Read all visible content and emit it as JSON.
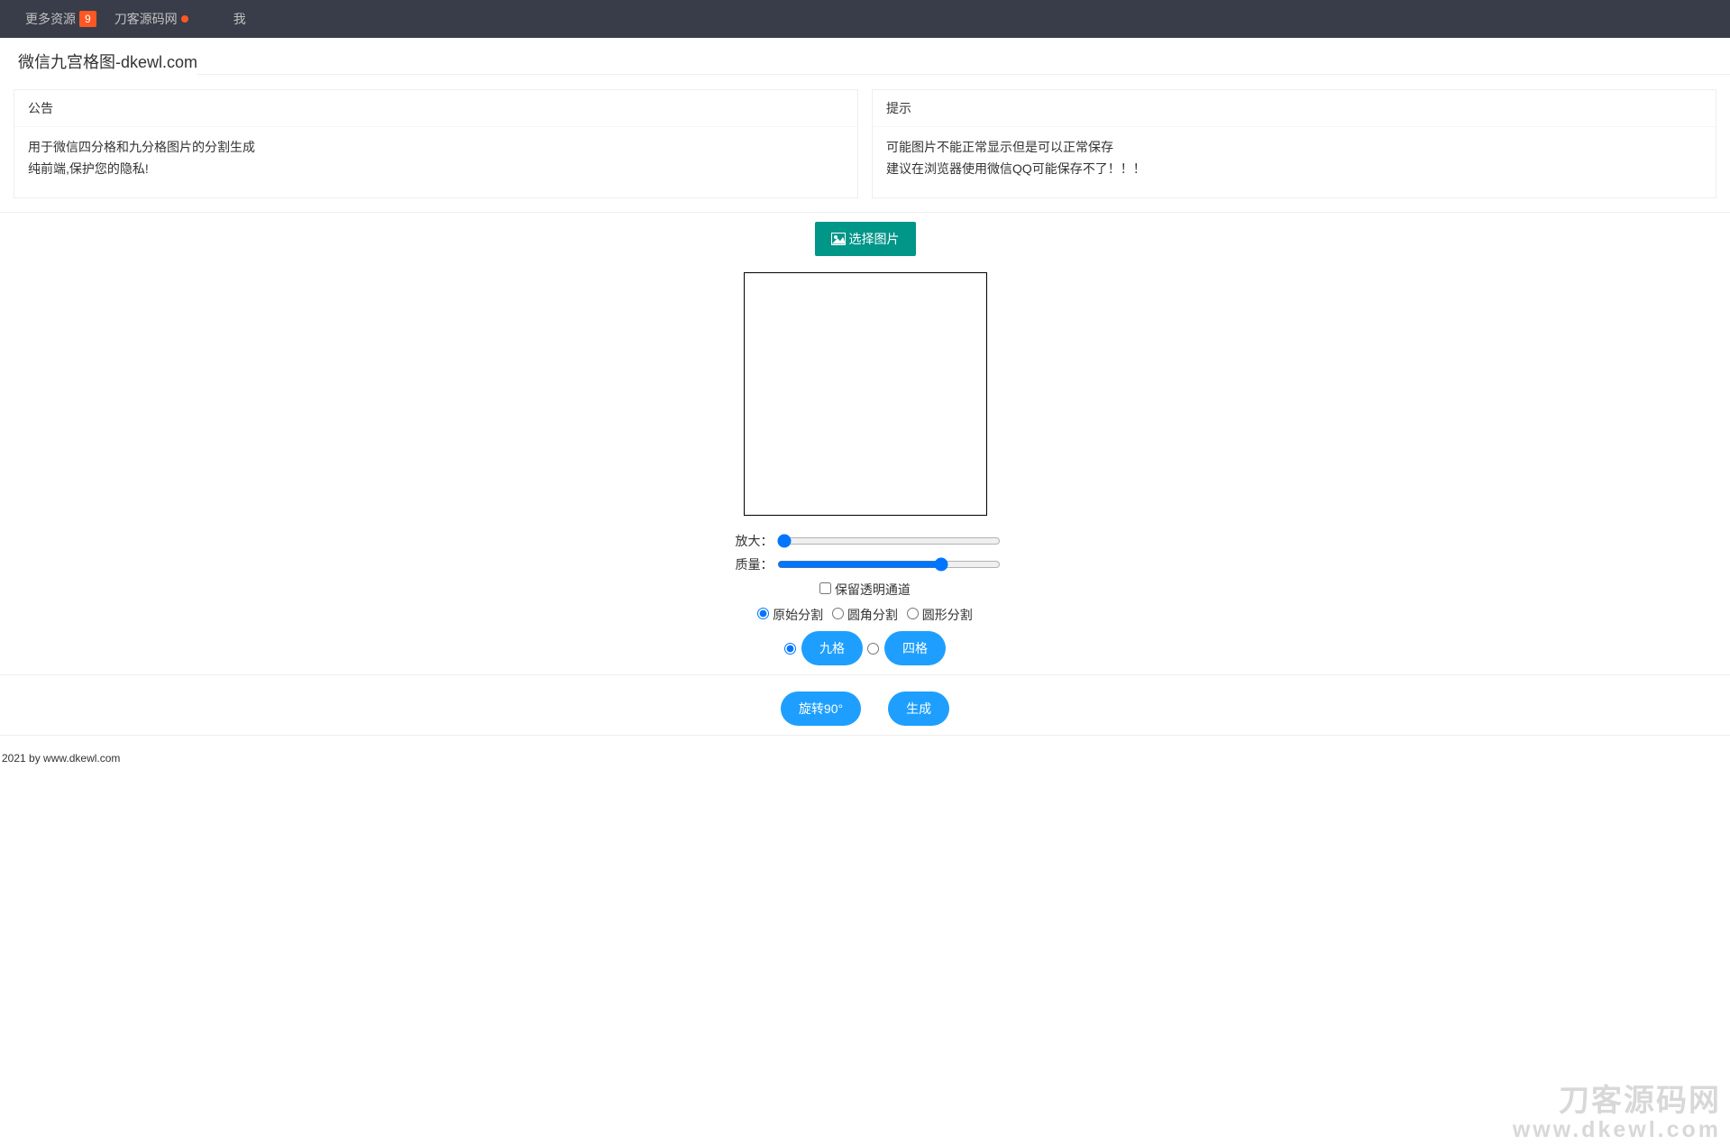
{
  "nav": {
    "more_resources": "更多资源",
    "badge": "9",
    "site_name": "刀客源码网",
    "me": "我"
  },
  "page_title": "微信九宫格图-dkewl.com",
  "cards": {
    "notice": {
      "header": "公告",
      "line1": "用于微信四分格和九分格图片的分割生成",
      "line2": "纯前端,保护您的隐私!"
    },
    "tip": {
      "header": "提示",
      "line1": "可能图片不能正常显示但是可以正常保存",
      "line2": "建议在浏览器使用微信QQ可能保存不了！！！"
    }
  },
  "buttons": {
    "choose_image": "选择图片",
    "rotate": "旋转90°",
    "generate": "生成",
    "nine": "九格",
    "four": "四格"
  },
  "controls": {
    "zoom_label": "放大：",
    "quality_label": "质量：",
    "alpha_label": "保留透明通道",
    "split_original": "原始分割",
    "split_rounded": "圆角分割",
    "split_circle": "圆形分割"
  },
  "footer": {
    "year": "2021 by ",
    "link": "www.dkewl.com"
  },
  "watermark": {
    "top": "刀客源码网",
    "bottom": "www.dkewl.com"
  }
}
